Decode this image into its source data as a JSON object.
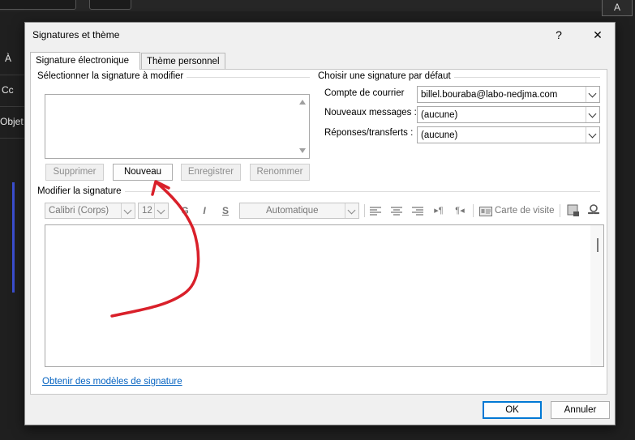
{
  "background": {
    "side_labels": [
      "À",
      "Cc",
      "Objet"
    ],
    "right_icon": "A"
  },
  "dialog": {
    "title": "Signatures et thème",
    "help_label": "?",
    "close_label": "✕"
  },
  "tabs": [
    {
      "label": "Signature électronique",
      "active": true
    },
    {
      "label": "Thème personnel",
      "active": false
    }
  ],
  "select_group": {
    "label": "Sélectionner la signature à modifier",
    "signatures": [],
    "buttons": {
      "delete": "Supprimer",
      "new": "Nouveau",
      "save": "Enregistrer",
      "rename": "Renommer"
    }
  },
  "default_group": {
    "label": "Choisir une signature par défaut",
    "account_label": "Compte de courrier",
    "account_value": "billel.bouraba@labo-nedjma.com",
    "new_messages_label": "Nouveaux messages :",
    "new_messages_value": "(aucune)",
    "replies_label": "Réponses/transferts :",
    "replies_value": "(aucune)"
  },
  "edit_group": {
    "label": "Modifier la signature",
    "font_value": "Calibri (Corps)",
    "size_value": "12",
    "bold": "G",
    "italic": "I",
    "underline": "S",
    "color_value": "Automatique",
    "business_card": "Carte de visite"
  },
  "footer": {
    "templates_link": "Obtenir des modèles de signature",
    "ok": "OK",
    "cancel": "Annuler"
  },
  "colors": {
    "annotation": "#d9202a",
    "link": "#0563c1",
    "dark_bg": "#1f1f1f"
  }
}
